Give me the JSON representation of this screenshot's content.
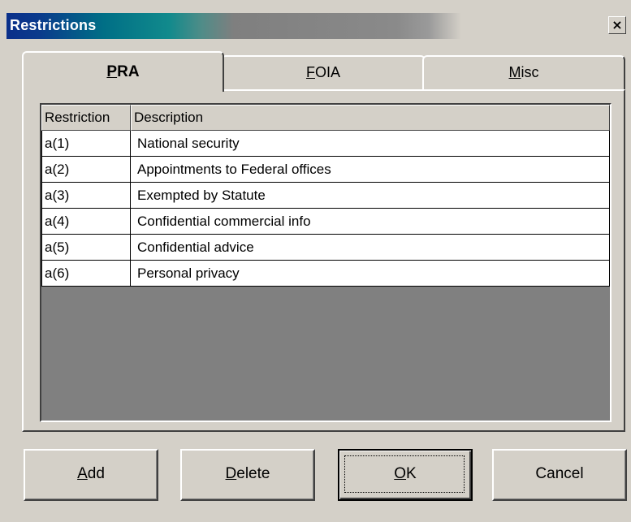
{
  "window": {
    "title": "Restrictions",
    "close_glyph": "×"
  },
  "tabs": [
    {
      "hotkey": "P",
      "rest": "RA",
      "active": true
    },
    {
      "hotkey": "F",
      "rest": "OIA",
      "active": false
    },
    {
      "hotkey": "M",
      "rest": "isc",
      "active": false
    }
  ],
  "table": {
    "columns": [
      "Restriction",
      "Description"
    ],
    "rows": [
      {
        "restriction": "a(1)",
        "description": "National security"
      },
      {
        "restriction": "a(2)",
        "description": "Appointments to Federal offices"
      },
      {
        "restriction": "a(3)",
        "description": "Exempted by Statute"
      },
      {
        "restriction": "a(4)",
        "description": "Confidential commercial info"
      },
      {
        "restriction": "a(5)",
        "description": "Confidential advice"
      },
      {
        "restriction": "a(6)",
        "description": "Personal privacy"
      }
    ]
  },
  "buttons": {
    "add": {
      "hotkey": "A",
      "rest": "dd"
    },
    "delete": {
      "hotkey": "D",
      "rest": "elete"
    },
    "ok": {
      "hotkey": "O",
      "rest": "K"
    },
    "cancel": {
      "label": "Cancel"
    }
  },
  "colors": {
    "face": "#d4d0c8",
    "title_start": "#0a2f8a",
    "title_end": "#808080",
    "grid_bg": "#808080"
  }
}
